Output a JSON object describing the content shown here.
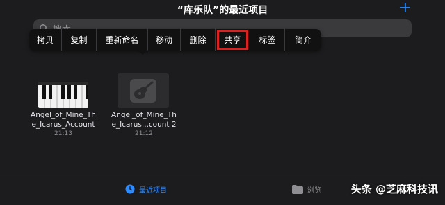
{
  "header": {
    "title": "“库乐队”的最近项目",
    "add_label": "+"
  },
  "search": {
    "placeholder": "搜索"
  },
  "context_menu": {
    "items": [
      {
        "label": "拷贝"
      },
      {
        "label": "复制"
      },
      {
        "label": "重新命名"
      },
      {
        "label": "移动"
      },
      {
        "label": "删除"
      },
      {
        "label": "共享",
        "highlighted": true
      },
      {
        "label": "标签"
      },
      {
        "label": "简介"
      }
    ],
    "highlight_color": "#e0201e"
  },
  "files": [
    {
      "name_line1": "Angel_of_Mine_Th",
      "name_line2": "e_Icarus_Account",
      "time": "21:13",
      "icon": "piano-keyboard-icon"
    },
    {
      "name_line1": "Angel_of_Mine_Th",
      "name_line2": "e_Icarus...count 2",
      "time": "21:12",
      "icon": "guitar-icon"
    }
  ],
  "tabbar": {
    "recents_label": "最近项目",
    "browse_label": "浏览",
    "active_color": "#2f8cff"
  },
  "watermark": {
    "text": "头条 @芝麻科技讯"
  }
}
